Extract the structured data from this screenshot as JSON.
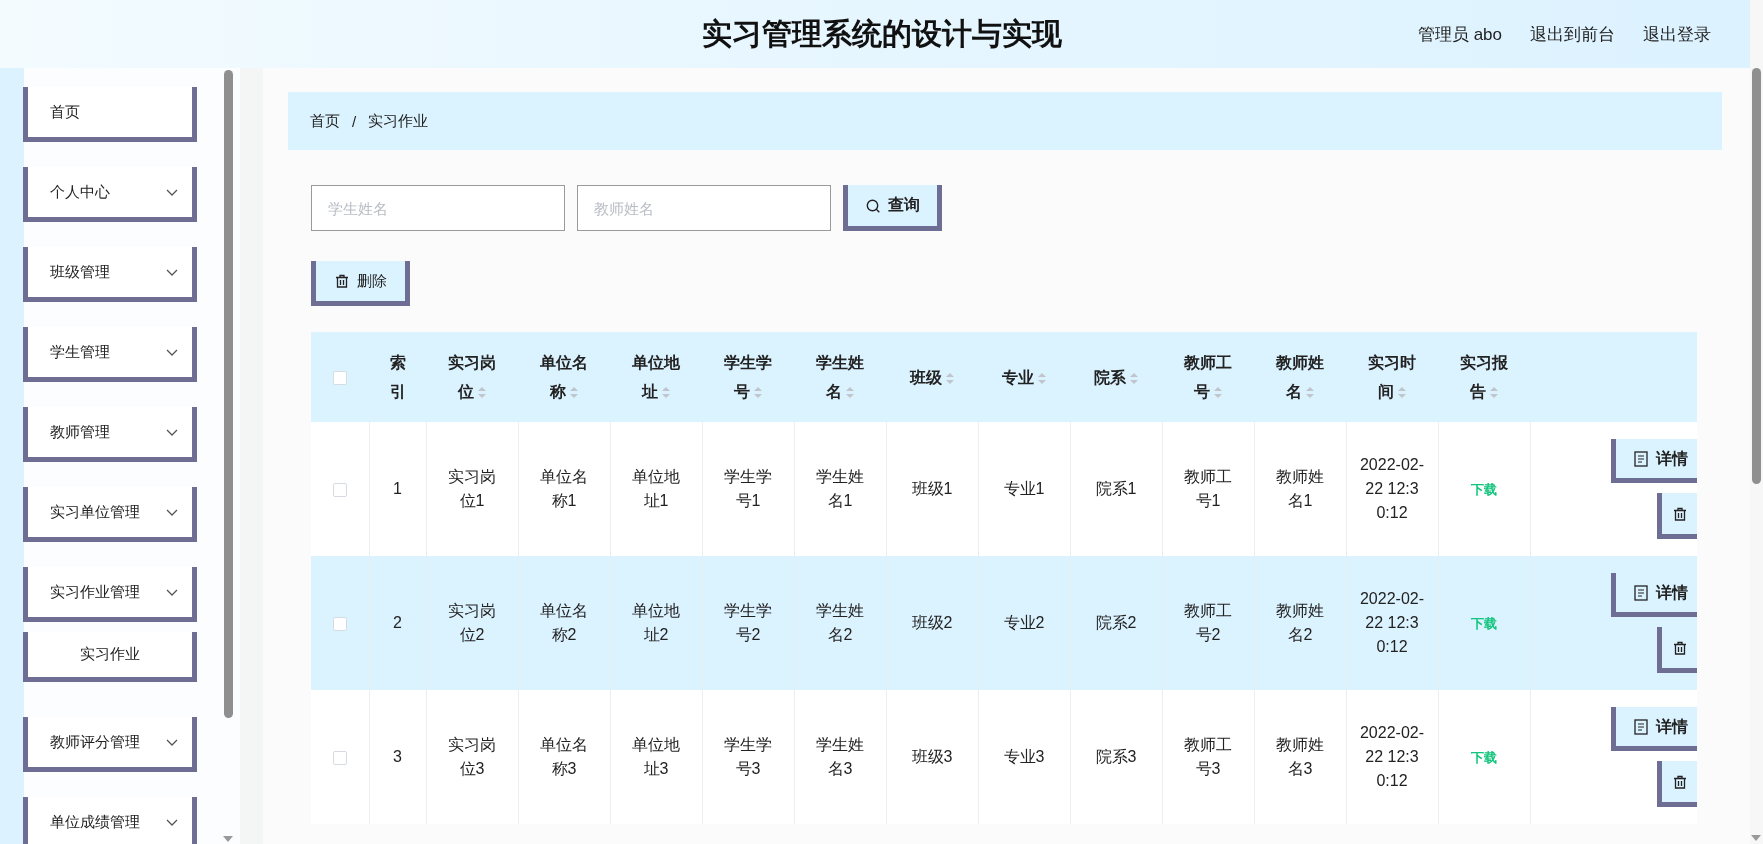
{
  "header": {
    "title": "实习管理系统的设计与实现",
    "links": [
      "管理员 abo",
      "退出到前台",
      "退出登录"
    ]
  },
  "sidebar": {
    "items": [
      {
        "label": "首页",
        "kind": "link"
      },
      {
        "label": "个人中心",
        "kind": "submenu"
      },
      {
        "label": "班级管理",
        "kind": "submenu"
      },
      {
        "label": "学生管理",
        "kind": "submenu"
      },
      {
        "label": "教师管理",
        "kind": "submenu"
      },
      {
        "label": "实习单位管理",
        "kind": "submenu"
      },
      {
        "label": "实习作业管理",
        "kind": "submenu",
        "children": [
          {
            "label": "实习作业"
          }
        ]
      },
      {
        "label": "教师评分管理",
        "kind": "submenu"
      },
      {
        "label": "单位成绩管理",
        "kind": "submenu"
      }
    ]
  },
  "breadcrumb": [
    "首页",
    "/",
    "实习作业"
  ],
  "search": {
    "fields": [
      {
        "placeholder": "学生姓名"
      },
      {
        "placeholder": "教师姓名"
      }
    ],
    "button": "查询"
  },
  "toolbar": {
    "delete_button": "删除"
  },
  "table": {
    "header_checked": false,
    "columns": [
      {
        "label": "索引",
        "sortable": false,
        "kind": "text"
      },
      {
        "label": "实习岗位",
        "sortable": true,
        "kind": "text"
      },
      {
        "label": "单位名称",
        "sortable": true,
        "kind": "text"
      },
      {
        "label": "单位地址",
        "sortable": true,
        "kind": "text"
      },
      {
        "label": "学生学号",
        "sortable": true,
        "kind": "text"
      },
      {
        "label": "学生姓名",
        "sortable": true,
        "kind": "text"
      },
      {
        "label": "班级",
        "sortable": true,
        "kind": "text"
      },
      {
        "label": "专业",
        "sortable": true,
        "kind": "text"
      },
      {
        "label": "院系",
        "sortable": true,
        "kind": "text"
      },
      {
        "label": "教师工号",
        "sortable": true,
        "kind": "text"
      },
      {
        "label": "教师姓名",
        "sortable": true,
        "kind": "text"
      },
      {
        "label": "实习时间",
        "sortable": true,
        "kind": "time"
      },
      {
        "label": "实习报告",
        "sortable": true,
        "kind": "link"
      }
    ],
    "rows": [
      {
        "checked": false,
        "cells": [
          "1",
          "实习岗位1",
          "单位名称1",
          "单位地址1",
          "学生学号1",
          "学生姓名1",
          "班级1",
          "专业1",
          "院系1",
          "教师工号1",
          "教师姓名1",
          "2022-02-22 12:30:12",
          "下载"
        ],
        "detail_button": "详情"
      },
      {
        "checked": false,
        "cells": [
          "2",
          "实习岗位2",
          "单位名称2",
          "单位地址2",
          "学生学号2",
          "学生姓名2",
          "班级2",
          "专业2",
          "院系2",
          "教师工号2",
          "教师姓名2",
          "2022-02-22 12:30:12",
          "下载"
        ],
        "detail_button": "详情"
      },
      {
        "checked": false,
        "cells": [
          "3",
          "实习岗位3",
          "单位名称3",
          "单位地址3",
          "学生学号3",
          "学生姓名3",
          "班级3",
          "专业3",
          "院系3",
          "教师工号3",
          "教师姓名3",
          "2022-02-22 12:30:12",
          "下载"
        ],
        "detail_button": "详情"
      }
    ]
  }
}
